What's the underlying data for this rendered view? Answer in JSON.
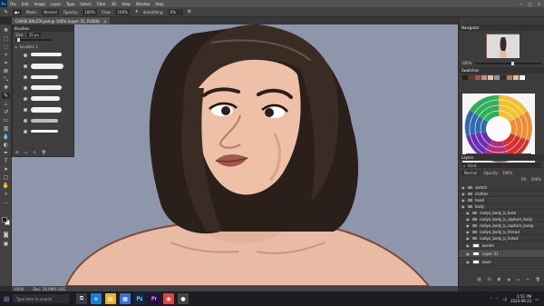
{
  "menubar": {
    "app_logo": "Ps",
    "items": [
      "File",
      "Edit",
      "Image",
      "Layer",
      "Type",
      "Select",
      "Filter",
      "3D",
      "View",
      "Window",
      "Help"
    ],
    "window_controls": [
      "—",
      "□",
      "✕"
    ]
  },
  "options": {
    "mode_label": "Mode:",
    "mode_value": "Normal",
    "opacity_label": "Opacity:",
    "opacity_value": "100%",
    "flow_label": "Flow:",
    "flow_value": "100%",
    "smoothing_label": "Smoothing:",
    "smoothing_value": "0%"
  },
  "tab": {
    "label": "CHASE KALETA.psd @ 100% (Layer 31, RGB/8)",
    "close": "×"
  },
  "brushes_panel": {
    "title": "Brushes",
    "size_label": "Size:",
    "size_value": "35 px",
    "group_label": "brushes 1"
  },
  "navigator": {
    "title": "Navigator",
    "zoom": "100%"
  },
  "swatches": {
    "title": "Swatches"
  },
  "layers_panel": {
    "title": "Layers",
    "search_placeholder": "Kind",
    "blend_mode": "Normal",
    "opacity_label": "Opacity:",
    "opacity_value": "100%",
    "fill_label": "Fill:",
    "fill_value": "100%",
    "layers": [
      {
        "name": "sketch",
        "type": "folder"
      },
      {
        "name": "clothes",
        "type": "folder"
      },
      {
        "name": "head",
        "type": "folder"
      },
      {
        "name": "body",
        "type": "folder"
      },
      {
        "name": "nadya_body_b_base",
        "type": "folder"
      },
      {
        "name": "nadya_body_b_capture_body",
        "type": "folder"
      },
      {
        "name": "nadya_body_b_capture_bump",
        "type": "folder"
      },
      {
        "name": "nadya_body_b_thread",
        "type": "folder"
      },
      {
        "name": "nadya_body_b_tinted",
        "type": "folder"
      },
      {
        "name": "border",
        "type": "layer"
      },
      {
        "name": "Layer 31",
        "type": "layer",
        "selected": true
      },
      {
        "name": "base",
        "type": "layer"
      }
    ]
  },
  "status": {
    "zoom": "100%",
    "doc": "Doc: 28.9M/1.60G"
  },
  "taskbar": {
    "search_placeholder": "Type here to search",
    "apps": [
      {
        "icon": "task-view-icon",
        "glyph": "⧉",
        "color": "#3a3a44"
      },
      {
        "icon": "edge-icon",
        "glyph": "e",
        "color": "#1a7fd1"
      },
      {
        "icon": "file-explorer-icon",
        "glyph": "▤",
        "color": "#e3b341"
      },
      {
        "icon": "store-icon",
        "glyph": "▦",
        "color": "#3b6fd1"
      },
      {
        "icon": "photoshop-icon",
        "glyph": "Ps",
        "color": "#0b2a4a"
      },
      {
        "icon": "premiere-icon",
        "glyph": "Pr",
        "color": "#2a0b4a"
      },
      {
        "icon": "chrome-icon",
        "glyph": "◉",
        "color": "#d44"
      },
      {
        "icon": "obs-icon",
        "glyph": "●",
        "color": "#444"
      }
    ],
    "time": "2:51 PM",
    "date": "2020-09-23"
  }
}
